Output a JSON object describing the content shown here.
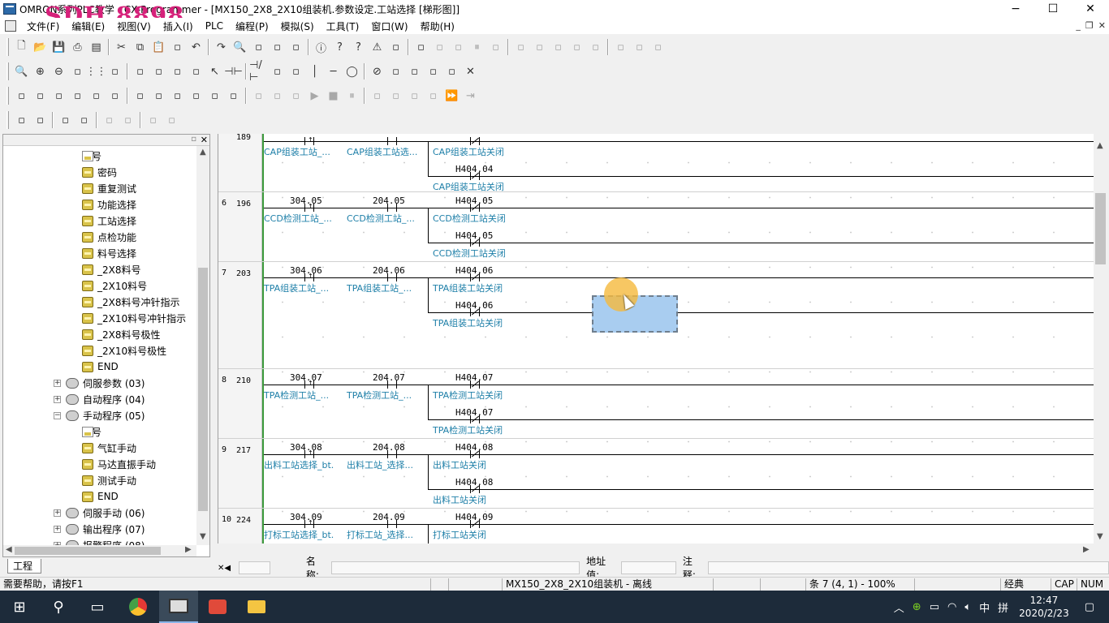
{
  "window": {
    "title": "OMRON系列PLC教学 - CX-Programmer - [MX150_2X8_2X10组装机.参数设定.工站选择 [梯形图]]",
    "watermark": "SDH 8898",
    "minimize": "−",
    "maximize": "☐",
    "close": "✕"
  },
  "menubar": {
    "items": [
      "文件(F)",
      "编辑(E)",
      "视图(V)",
      "插入(I)",
      "PLC",
      "编程(P)",
      "模拟(S)",
      "工具(T)",
      "窗口(W)",
      "帮助(H)"
    ]
  },
  "toolbars": {
    "row1": [
      "new-icon",
      "open-icon",
      "save-icon",
      "print-icon",
      "print-preview-icon",
      "cut-icon",
      "copy-icon",
      "paste-icon",
      "transfer-icon",
      "undo-icon",
      "redo-icon",
      "find-icon",
      "replace-icon",
      "address-ref-icon",
      "cross-ref-icon",
      "info-icon",
      "help-icon",
      "context-help-icon",
      "warning-icon",
      "compile-icon",
      "online-icon",
      "program-check-icon",
      "monitor-icon",
      "pause-icon",
      "compare-icon",
      "upload-icon",
      "download-icon",
      "transfer-plc-icon",
      "edit-online-icon",
      "mode-icon",
      "step-icon",
      "data-trace-icon",
      "io-table-icon"
    ],
    "row2": [
      "zoom-icon",
      "zoom-in-icon",
      "zoom-out-icon",
      "zoom-fit-icon",
      "grid-icon",
      "comment-icon",
      "rung-comment-icon",
      "symbol-icon",
      "mnemonic-icon",
      "ladder-icon",
      "select-icon",
      "contact-no-icon",
      "contact-nc-icon",
      "contact-or-icon",
      "contact-orn-icon",
      "vertical-line-icon",
      "horizontal-line-icon",
      "coil-icon",
      "coil-nc-icon",
      "instruction-icon",
      "fb-icon",
      "ladder-fb-icon",
      "input-line-icon",
      "delete-icon"
    ],
    "row3": [
      "project-icon",
      "output-icon",
      "watch-icon",
      "address-icon",
      "properties-icon",
      "cross-ref-table-icon",
      "memory-icon",
      "sections-icon",
      "io-comment-icon",
      "bit-icon",
      "word-icon",
      "dword-icon",
      "timer-icon",
      "counter-icon",
      "sim-icon",
      "run-icon",
      "stop-icon",
      "step-run-icon",
      "break-icon",
      "step-in-icon",
      "step-out-icon",
      "step-over-icon",
      "continue-icon",
      "jump-icon"
    ],
    "row4": [
      "indent-icon",
      "outdent-icon",
      "list-icon",
      "list-alt-icon",
      "pin-icon",
      "unpin-icon",
      "bookmark-icon",
      "bookmark-clear-icon"
    ]
  },
  "tree": {
    "items": [
      {
        "label": "符号",
        "icon": "symbol-table-icon",
        "level": 2,
        "expander": ""
      },
      {
        "label": "密码",
        "icon": "section-icon",
        "level": 2,
        "expander": ""
      },
      {
        "label": "重复测试",
        "icon": "section-icon",
        "level": 2,
        "expander": ""
      },
      {
        "label": "功能选择",
        "icon": "section-icon",
        "level": 2,
        "expander": ""
      },
      {
        "label": "工站选择",
        "icon": "section-icon",
        "level": 2,
        "expander": ""
      },
      {
        "label": "点检功能",
        "icon": "section-icon",
        "level": 2,
        "expander": ""
      },
      {
        "label": "料号选择",
        "icon": "section-icon",
        "level": 2,
        "expander": ""
      },
      {
        "label": "_2X8料号",
        "icon": "section-icon",
        "level": 2,
        "expander": ""
      },
      {
        "label": "_2X10料号",
        "icon": "section-icon",
        "level": 2,
        "expander": ""
      },
      {
        "label": "_2X8料号冲针指示",
        "icon": "section-icon",
        "level": 2,
        "expander": ""
      },
      {
        "label": "_2X10料号冲针指示",
        "icon": "section-icon",
        "level": 2,
        "expander": ""
      },
      {
        "label": "_2X8料号极性",
        "icon": "section-icon",
        "level": 2,
        "expander": ""
      },
      {
        "label": "_2X10料号极性",
        "icon": "section-icon",
        "level": 2,
        "expander": ""
      },
      {
        "label": "END",
        "icon": "section-icon",
        "level": 2,
        "expander": ""
      },
      {
        "label": "伺服参数 (03)",
        "icon": "program-icon",
        "level": 1,
        "expander": "+"
      },
      {
        "label": "自动程序 (04)",
        "icon": "program-icon",
        "level": 1,
        "expander": "+"
      },
      {
        "label": "手动程序 (05)",
        "icon": "program-icon",
        "level": 1,
        "expander": "−"
      },
      {
        "label": "符号",
        "icon": "symbol-table-icon",
        "level": 2,
        "expander": ""
      },
      {
        "label": "气缸手动",
        "icon": "section-icon",
        "level": 2,
        "expander": ""
      },
      {
        "label": "马达直振手动",
        "icon": "section-icon",
        "level": 2,
        "expander": ""
      },
      {
        "label": "测试手动",
        "icon": "section-icon",
        "level": 2,
        "expander": ""
      },
      {
        "label": "END",
        "icon": "section-icon",
        "level": 2,
        "expander": ""
      },
      {
        "label": "伺服手动 (06)",
        "icon": "program-icon",
        "level": 1,
        "expander": "+"
      },
      {
        "label": "输出程序 (07)",
        "icon": "program-icon",
        "level": 1,
        "expander": "+"
      },
      {
        "label": "报警程序 (08)",
        "icon": "program-icon",
        "level": 1,
        "expander": "+"
      }
    ],
    "tab_label": "工程"
  },
  "ladder": {
    "rungs": [
      {
        "num": "",
        "step": "189",
        "c1_addr": "",
        "c1_sym": "CAP组装工站_...",
        "c2_addr": "",
        "c2_sym": "CAP组装工站选...",
        "c3_addr": "",
        "c3_sym": "CAP组装工站关闭",
        "c4_addr": "H404.04",
        "c4_sym": "CAP组装工站关闭"
      },
      {
        "num": "6",
        "step": "196",
        "c1_addr": "304.05",
        "c1_sym": "CCD检测工站_...",
        "c2_addr": "204.05",
        "c2_sym": "CCD检测工站_...",
        "c3_addr": "H404.05",
        "c3_sym": "CCD检测工站关闭",
        "c4_addr": "H404.05",
        "c4_sym": "CCD检测工站关闭"
      },
      {
        "num": "7",
        "step": "203",
        "c1_addr": "304.06",
        "c1_sym": "TPA组装工站_...",
        "c2_addr": "204.06",
        "c2_sym": "TPA组装工站_...",
        "c3_addr": "H404.06",
        "c3_sym": "TPA组装工站关闭",
        "c4_addr": "H404.06",
        "c4_sym": "TPA组装工站关闭"
      },
      {
        "num": "8",
        "step": "210",
        "c1_addr": "304.07",
        "c1_sym": "TPA检测工站_...",
        "c2_addr": "204.07",
        "c2_sym": "TPA检测工站_...",
        "c3_addr": "H404.07",
        "c3_sym": "TPA检测工站关闭",
        "c4_addr": "H404.07",
        "c4_sym": "TPA检测工站关闭"
      },
      {
        "num": "9",
        "step": "217",
        "c1_addr": "304.08",
        "c1_sym": "出料工站选择_bt.",
        "c2_addr": "204.08",
        "c2_sym": "出料工站_选择...",
        "c3_addr": "H404.08",
        "c3_sym": "出料工站关闭",
        "c4_addr": "H404.08",
        "c4_sym": "出料工站关闭"
      },
      {
        "num": "10",
        "step": "224",
        "c1_addr": "304.09",
        "c1_sym": "打标工站选择_bt.",
        "c2_addr": "204.09",
        "c2_sym": "打标工站_选择...",
        "c3_addr": "H404.09",
        "c3_sym": "打标工站关闭",
        "c4_addr": "",
        "c4_sym": ""
      }
    ]
  },
  "infobar": {
    "name_label": "名称:",
    "address_label": "地址值:",
    "comment_label": "注释:"
  },
  "statusbar": {
    "help": "需要帮助，请按F1",
    "project": "MX150_2X8_2X10组装机 - 离线",
    "position": "条 7 (4, 1)  - 100%",
    "mode": "经典",
    "caps": "CAP",
    "num": "NUM"
  },
  "taskbar": {
    "time": "12:47",
    "date": "2020/2/23",
    "ime": "中",
    "ime2": "拼"
  }
}
